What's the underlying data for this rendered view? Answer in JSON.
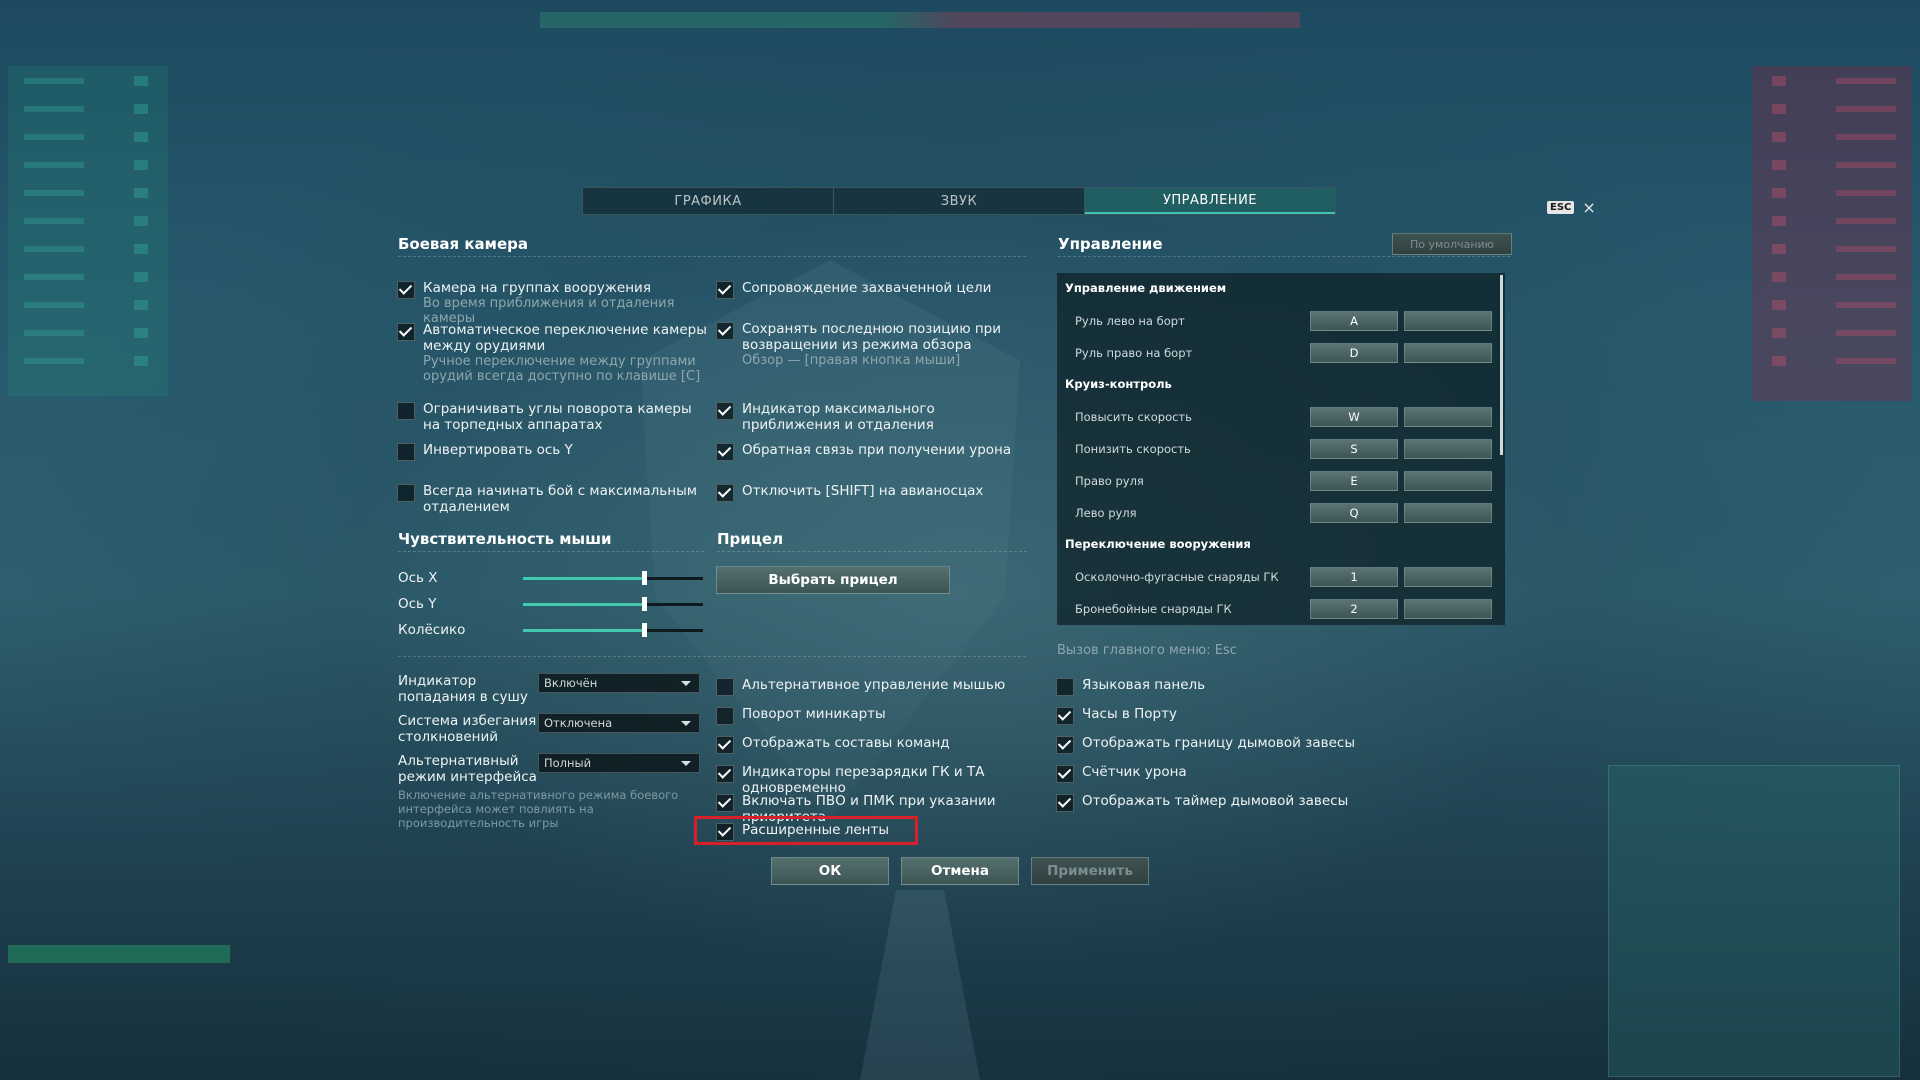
{
  "tabs": [
    {
      "label": "ГРАФИКА",
      "active": false
    },
    {
      "label": "ЗВУК",
      "active": false
    },
    {
      "label": "УПРАВЛЕНИЕ",
      "active": true
    }
  ],
  "close": {
    "key_label": "ESC",
    "icon": "×"
  },
  "battle_camera": {
    "title": "Боевая камера",
    "left_options": [
      {
        "label": "Камера на группах вооружения",
        "sub": "Во время приближения и отдаления камеры",
        "checked": true
      },
      {
        "label": "Автоматическое переключение камеры между орудиями",
        "sub": "Ручное переключение между группами орудий всегда доступно по клавише [C]",
        "checked": true
      },
      {
        "label": "Ограничивать углы поворота камеры на торпедных аппаратах",
        "sub": "",
        "checked": false
      },
      {
        "label": "Инвертировать ось Y",
        "sub": "",
        "checked": false
      },
      {
        "label": "Всегда начинать бой с максимальным отдалением",
        "sub": "",
        "checked": false
      }
    ],
    "right_options": [
      {
        "label": "Сопровождение захваченной цели",
        "sub": "",
        "checked": true
      },
      {
        "label": "Сохранять последнюю позицию при возвращении из режима обзора",
        "sub": "Обзор — [правая кнопка мыши]",
        "checked": true
      },
      {
        "label": "Индикатор максимального приближения и отдаления",
        "sub": "",
        "checked": true
      },
      {
        "label": "Обратная связь при получении урона",
        "sub": "",
        "checked": true
      },
      {
        "label": "Отключить [SHIFT] на авианосцах",
        "sub": "",
        "checked": true
      }
    ]
  },
  "mouse_sensitivity": {
    "title": "Чувствительность мыши",
    "sliders": [
      {
        "label": "Ось X",
        "value": 0.67
      },
      {
        "label": "Ось Y",
        "value": 0.67
      },
      {
        "label": "Колёсико",
        "value": 0.67
      }
    ]
  },
  "sight": {
    "title": "Прицел",
    "button_label": "Выбрать прицел"
  },
  "dropdowns": [
    {
      "label": "Индикатор попадания в сушу",
      "value": "Включён"
    },
    {
      "label": "Система избегания столкновений",
      "value": "Отключена"
    },
    {
      "label": "Альтернативный режим интерфейса",
      "value": "Полный"
    }
  ],
  "alt_mode_note": "Включение альтернативного режима боевого интерфейса может повлиять на производительность игры",
  "middle_options": [
    {
      "label": "Альтернативное управление мышью",
      "checked": false
    },
    {
      "label": "Поворот миникарты",
      "checked": false
    },
    {
      "label": "Отображать составы команд",
      "checked": true
    },
    {
      "label": "Индикаторы перезарядки ГК и ТА одновременно",
      "checked": true
    },
    {
      "label": "Включать ПВО и ПМК при указании приоритета",
      "checked": true
    },
    {
      "label": "Расширенные ленты",
      "checked": true
    }
  ],
  "right_bottom_options": [
    {
      "label": "Языковая панель",
      "checked": false
    },
    {
      "label": "Часы в Порту",
      "checked": true
    },
    {
      "label": "Отображать границу дымовой завесы",
      "checked": true
    },
    {
      "label": "Счётчик урона",
      "checked": true
    },
    {
      "label": "Отображать таймер дымовой завесы",
      "checked": true
    }
  ],
  "controls": {
    "title": "Управление",
    "default_button": "По умолчанию",
    "menu_hint": "Вызов главного меню: Esc",
    "categories": [
      {
        "name": "Управление движением",
        "rows": [
          {
            "action": "Руль лево на борт",
            "key1": "A",
            "key2": ""
          },
          {
            "action": "Руль право на борт",
            "key1": "D",
            "key2": ""
          }
        ]
      },
      {
        "name": "Круиз-контроль",
        "rows": [
          {
            "action": "Повысить скорость",
            "key1": "W",
            "key2": ""
          },
          {
            "action": "Понизить скорость",
            "key1": "S",
            "key2": ""
          },
          {
            "action": "Право руля",
            "key1": "E",
            "key2": ""
          },
          {
            "action": "Лево руля",
            "key1": "Q",
            "key2": ""
          }
        ]
      },
      {
        "name": "Переключение вооружения",
        "rows": [
          {
            "action": "Осколочно-фугасные снаряды ГК",
            "key1": "1",
            "key2": ""
          },
          {
            "action": "Бронебойные снаряды ГК",
            "key1": "2",
            "key2": ""
          }
        ]
      }
    ]
  },
  "footer": {
    "ok": "ОК",
    "cancel": "Отмена",
    "apply": "Применить"
  },
  "colors": {
    "accent": "#43c9b0",
    "highlight": "#d8202a"
  }
}
